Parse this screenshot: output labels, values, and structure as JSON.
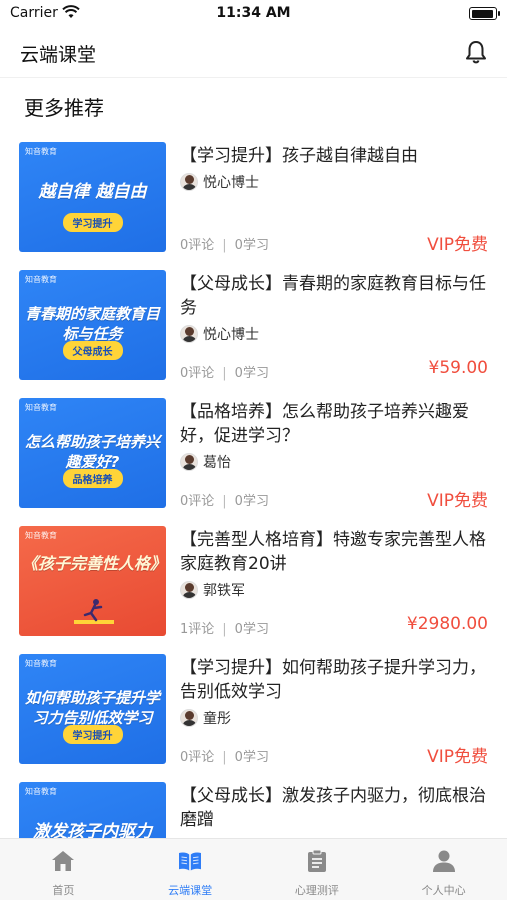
{
  "status_bar": {
    "carrier": "Carrier",
    "time": "11:34 AM"
  },
  "header": {
    "title": "云端课堂"
  },
  "section": {
    "title": "更多推荐"
  },
  "courses": [
    {
      "thumb_logo": "知音教育",
      "thumb_text": "越自律 越自由",
      "thumb_tag": "学习提升",
      "title": "【学习提升】孩子越自律越自由",
      "author": "悦心博士",
      "comments": "0评论",
      "learners": "0学习",
      "price": "VIP免费"
    },
    {
      "thumb_logo": "知音教育",
      "thumb_text": "青春期的家庭教育目标与任务",
      "thumb_tag": "父母成长",
      "title": "【父母成长】青春期的家庭教育目标与任务",
      "author": "悦心博士",
      "comments": "0评论",
      "learners": "0学习",
      "price": "¥59.00"
    },
    {
      "thumb_logo": "知音教育",
      "thumb_text": "怎么帮助孩子培养兴趣爱好?",
      "thumb_tag": "品格培养",
      "title": "【品格培养】怎么帮助孩子培养兴趣爱好，促进学习？",
      "author": "葛怡",
      "comments": "0评论",
      "learners": "0学习",
      "price": "VIP免费"
    },
    {
      "thumb_logo": "知音教育",
      "thumb_text": "《孩子完善性人格》",
      "thumb_tag": "",
      "title": "【完善型人格培育】特邀专家完善型人格家庭教育20讲",
      "author": "郭铁军",
      "comments": "1评论",
      "learners": "0学习",
      "price": "¥2980.00"
    },
    {
      "thumb_logo": "知音教育",
      "thumb_text": "如何帮助孩子提升学习力告别低效学习",
      "thumb_tag": "学习提升",
      "title": "【学习提升】如何帮助孩子提升学习力，告别低效学习",
      "author": "童彤",
      "comments": "0评论",
      "learners": "0学习",
      "price": "VIP免费"
    },
    {
      "thumb_logo": "知音教育",
      "thumb_text": "激发孩子内驱力",
      "thumb_tag": "",
      "title": "【父母成长】激发孩子内驱力，彻底根治磨蹭",
      "author": "",
      "comments": "",
      "learners": "",
      "price": ""
    }
  ],
  "tabs": [
    {
      "label": "首页",
      "icon": "home-icon"
    },
    {
      "label": "云端课堂",
      "icon": "book-icon"
    },
    {
      "label": "心理测评",
      "icon": "clipboard-icon"
    },
    {
      "label": "个人中心",
      "icon": "user-icon"
    }
  ],
  "colors": {
    "accent": "#2f7df6",
    "price": "#f04e3e",
    "thumb_blue": "#2f85f6",
    "thumb_red": "#f0573c"
  }
}
